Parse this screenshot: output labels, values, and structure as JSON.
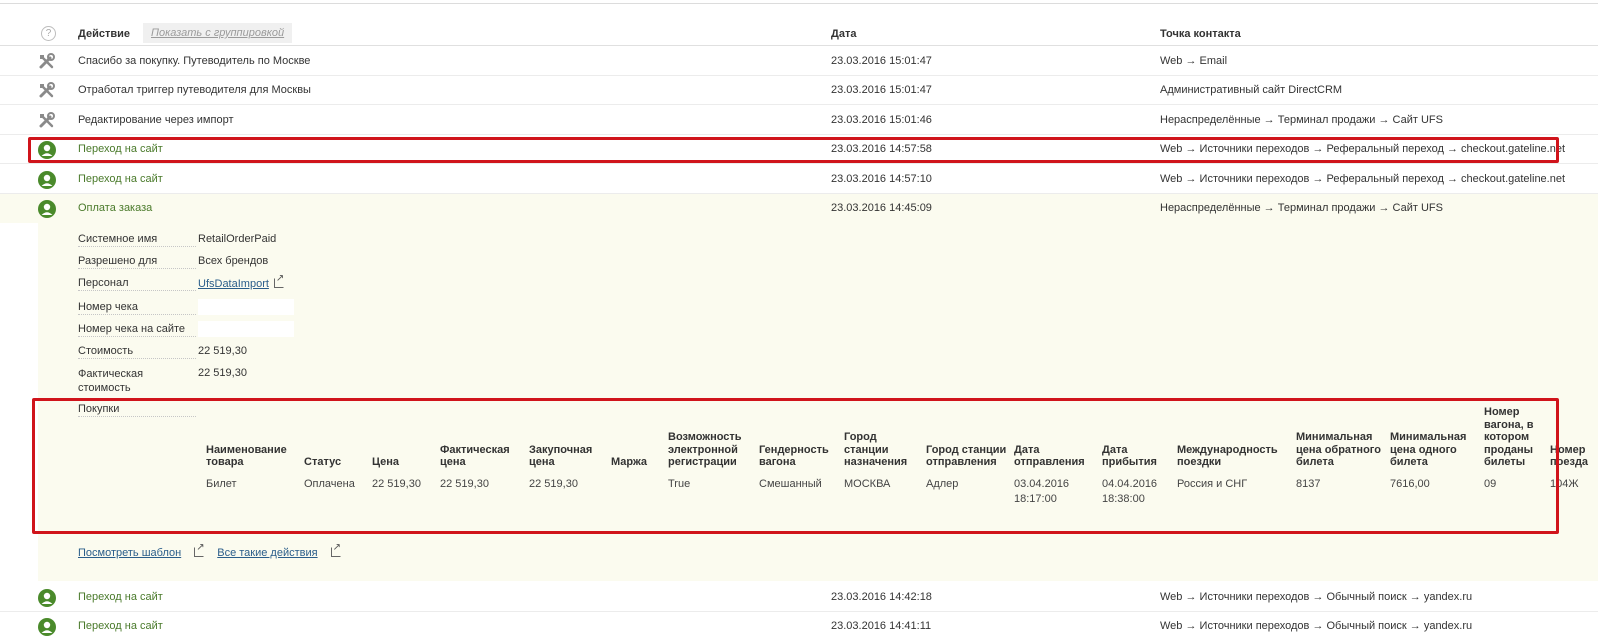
{
  "header": {
    "help": "?",
    "action": "Действие",
    "group_toggle": "Показать с группировкой",
    "date": "Дата",
    "contact": "Точка контакта"
  },
  "rows": [
    {
      "icon": "tools-icon",
      "action": "Спасибо за покупку. Путеводитель по Москве",
      "date": "23.03.2016 15:01:47",
      "contact": "Web → Email"
    },
    {
      "icon": "tools-icon",
      "action": "Отработал триггер путеводителя для Москвы",
      "date": "23.03.2016 15:01:47",
      "contact": "Административный сайт DirectCRM"
    },
    {
      "icon": "tools-icon",
      "action": "Редактирование через импорт",
      "date": "23.03.2016 15:01:46",
      "contact": "Нераспределённые → Терминал продажи → Сайт UFS"
    },
    {
      "icon": "user-icon",
      "action": "Переход на сайт",
      "date": "23.03.2016 14:57:58",
      "contact": "Web → Источники переходов → Реферальный переход → checkout.gateline.net"
    },
    {
      "icon": "user-icon",
      "action": "Переход на сайт",
      "date": "23.03.2016 14:57:10",
      "contact": "Web → Источники переходов → Реферальный переход → checkout.gateline.net"
    },
    {
      "icon": "user-icon",
      "action": "Оплата заказа",
      "date": "23.03.2016 14:45:09",
      "contact": "Нераспределённые → Терминал продажи → Сайт UFS"
    },
    {
      "icon": "user-icon",
      "action": "Переход на сайт",
      "date": "23.03.2016 14:42:18",
      "contact": "Web → Источники переходов → Обычный поиск → yandex.ru"
    },
    {
      "icon": "user-icon",
      "action": "Переход на сайт",
      "date": "23.03.2016 14:41:11",
      "contact": "Web → Источники переходов → Обычный поиск → yandex.ru"
    }
  ],
  "details": [
    {
      "label": "Системное имя",
      "value": "RetailOrderPaid"
    },
    {
      "label": "Разрешено для",
      "value": "Всех брендов"
    },
    {
      "label": "Персонал",
      "value": "UfsDataImport"
    },
    {
      "label": "Номер чека",
      "value": ""
    },
    {
      "label": "Номер чека на сайте",
      "value": ""
    },
    {
      "label": "Стоимость",
      "value": "22 519,30"
    },
    {
      "label": "Фактическая стоимость",
      "value": "22 519,30"
    },
    {
      "label": "Покупки",
      "value": ""
    }
  ],
  "purchases": {
    "headers": [
      "Наименование товара",
      "Статус",
      "Цена",
      "Фактическая цена",
      "Закупочная цена",
      "Маржа",
      "Возможность электронной регистрации",
      "Гендерность вагона",
      "Город станции назначения",
      "Город станции отправления",
      "Дата отправления",
      "Дата прибытия",
      "Международность поездки",
      "Минимальная цена обратного билета",
      "Минимальная цена одного билета",
      "Номер вагона, в котором проданы билеты",
      "Номер поезда"
    ],
    "row": [
      "Билет",
      "Оплачена",
      "22 519,30",
      "22 519,30",
      "22 519,30",
      "",
      "True",
      "Смешанный",
      "МОСКВА",
      "Адлер",
      "03.04.2016 18:17:00",
      "04.04.2016 18:38:00",
      "Россия и СНГ",
      "8137",
      "7616,00",
      "09",
      "104Ж"
    ]
  },
  "links": {
    "template": "Посмотреть шаблон",
    "all_actions": "Все такие действия"
  },
  "colors": {
    "highlight": "#d0141b",
    "user_icon": "#4a8a2b",
    "expanded_bg": "#fbfbef",
    "link": "#2a5d8a"
  }
}
